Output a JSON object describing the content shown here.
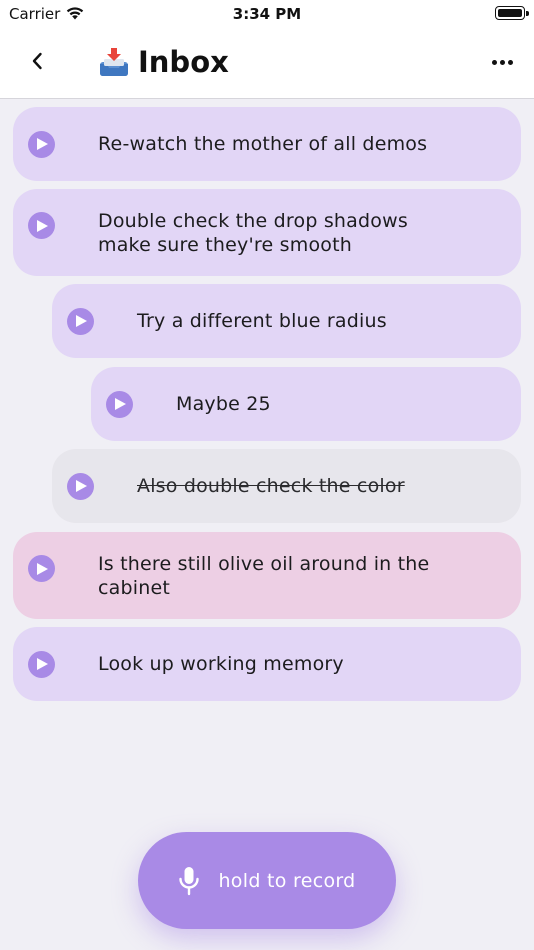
{
  "status_bar": {
    "carrier": "Carrier",
    "time": "3:34 PM"
  },
  "nav": {
    "title": "Inbox",
    "icon": "inbox-tray-icon"
  },
  "items": [
    {
      "text": "Re-watch the mother of all demos",
      "indent": 0,
      "color": "purple",
      "done": false
    },
    {
      "text": "Double check the drop shadows make sure they're smooth",
      "indent": 0,
      "color": "purple",
      "done": false
    },
    {
      "text": "Try a different blue radius",
      "indent": 1,
      "color": "purple",
      "done": false
    },
    {
      "text": "Maybe 25",
      "indent": 2,
      "color": "purple",
      "done": false
    },
    {
      "text": "Also double check the color",
      "indent": 1,
      "color": "gray",
      "done": true
    },
    {
      "text": "Is there still olive oil around in the cabinet",
      "indent": 0,
      "color": "pink",
      "done": false
    },
    {
      "text": "Look up working memory",
      "indent": 0,
      "color": "purple",
      "done": false
    }
  ],
  "record": {
    "label": "hold to record"
  },
  "colors": {
    "accent": "#a98ae6",
    "purple_item": "#e2d6f6",
    "pink_item": "#edcfe4",
    "done_item": "#e7e6ec",
    "background": "#f0eff5"
  }
}
